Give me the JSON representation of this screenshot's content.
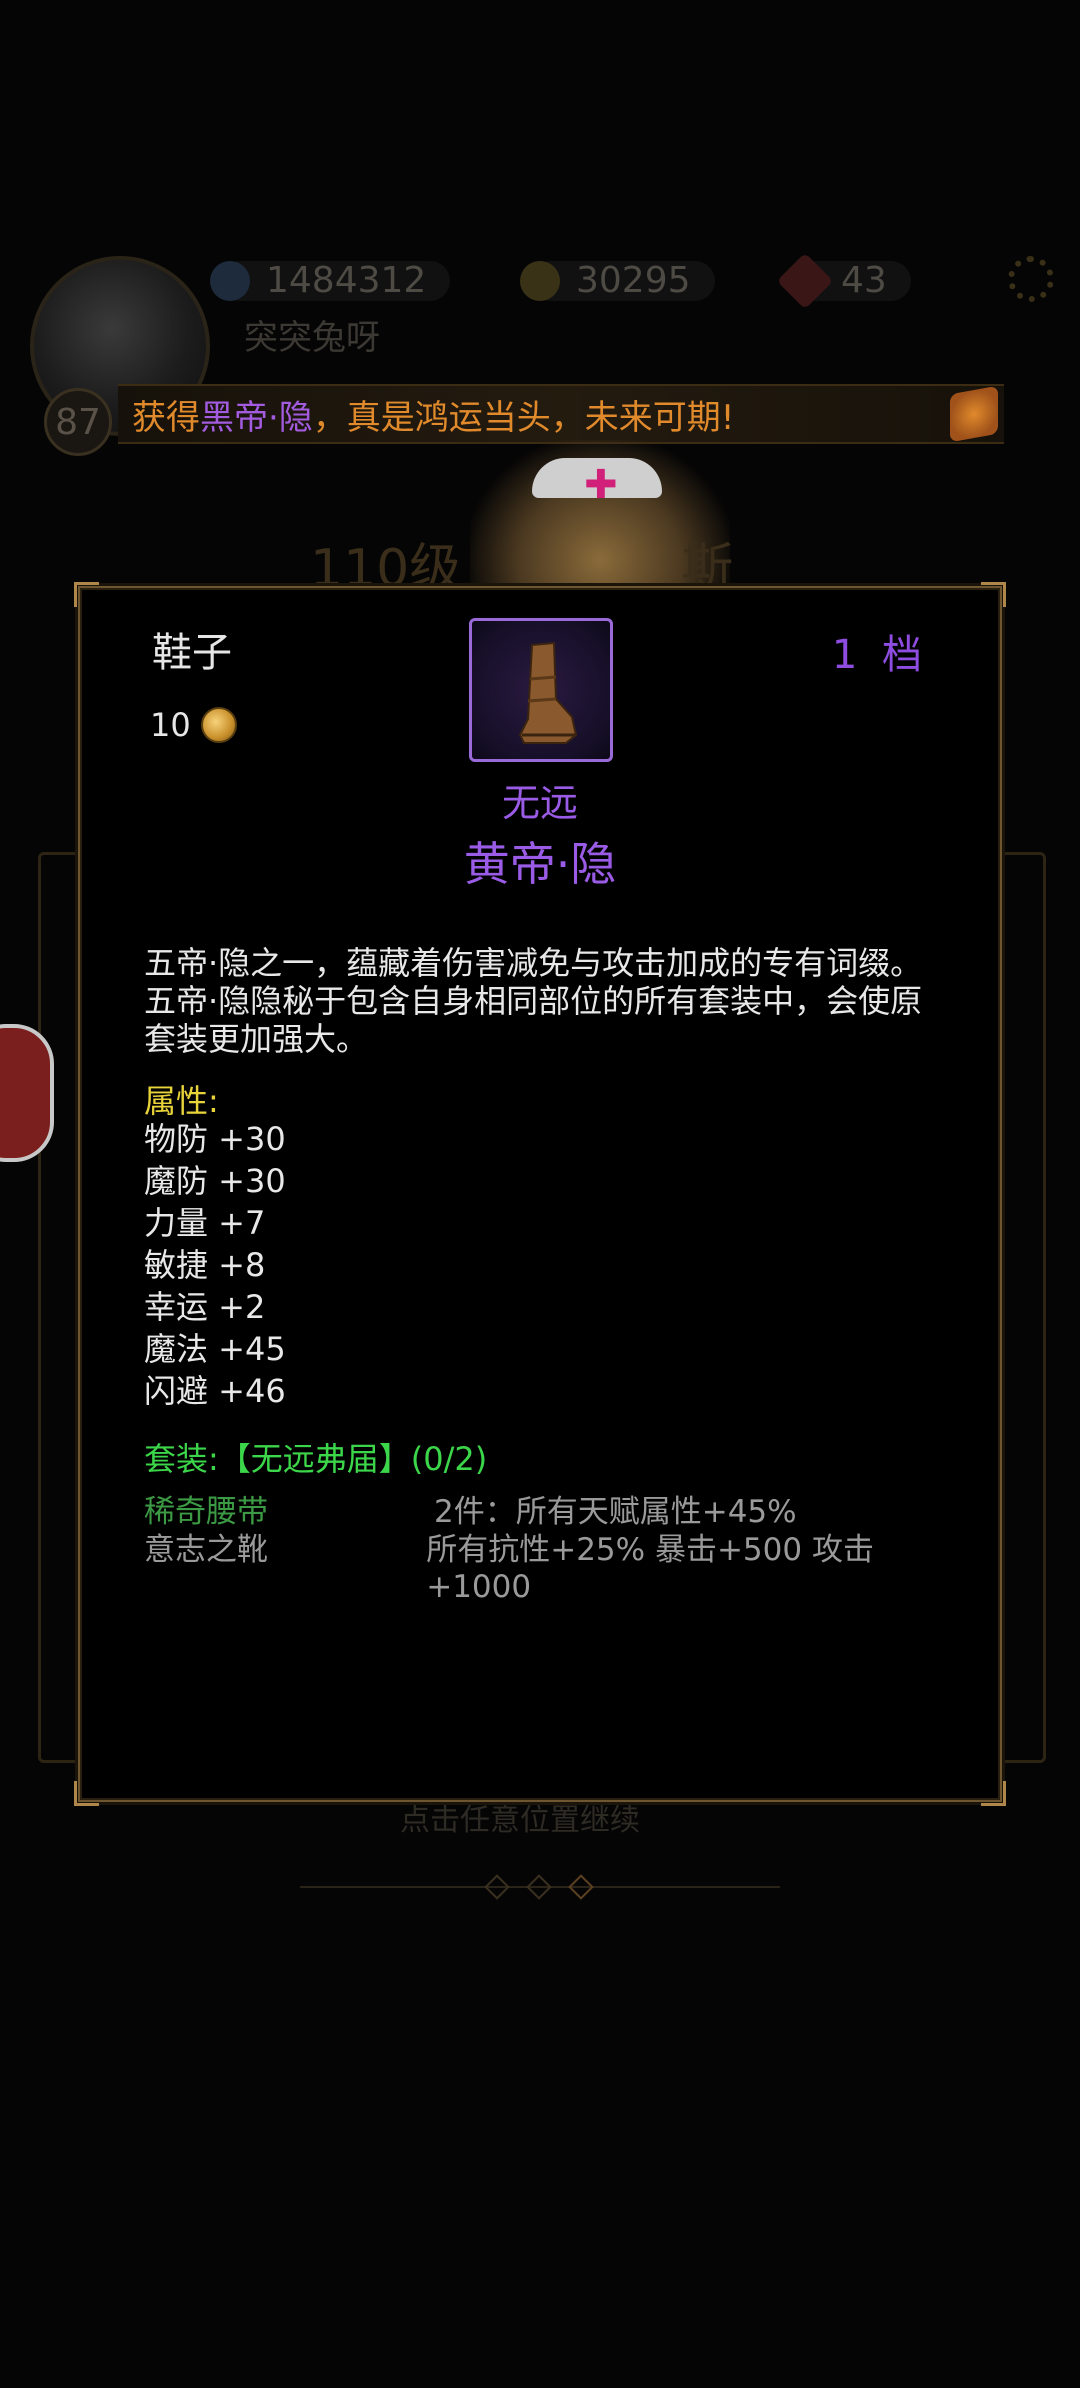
{
  "player": {
    "name": "突突兔呀",
    "level": "87"
  },
  "resources": {
    "power": "1484312",
    "gold": "30295",
    "gems": "43"
  },
  "banner": {
    "prefix": "获得",
    "highlight": "黑帝·隐",
    "suffix": "，真是鸿运当头，未来可期!"
  },
  "background": {
    "title": "110级",
    "title_tail": "斯",
    "hint": "点击任意位置继续"
  },
  "item": {
    "slot": "鞋子",
    "price": "10",
    "tier": "1 档",
    "set_name": "无远",
    "name": "黄帝·隐",
    "icon": "boot-icon",
    "rarity_color": "#9a5be6",
    "description": "五帝·隐之一，蕴藏着伤害减免与攻击加成的专有词缀。五帝·隐隐秘于包含自身相同部位的所有套装中，会使原套装更加强大。",
    "attributes_title": "属性:",
    "attributes": [
      "物防 +30",
      "魔防 +30",
      "力量 +7",
      "敏捷 +8",
      "幸运 +2",
      "魔法 +45",
      "闪避 +46"
    ],
    "set_bonus": {
      "title": "套装:【无远弗届】(0/2)",
      "pieces": [
        "稀奇腰带",
        "意志之靴"
      ],
      "bonuses": [
        "2件：所有天赋属性+45%",
        "所有抗性+25% 暴击+500 攻击+1000"
      ]
    }
  }
}
